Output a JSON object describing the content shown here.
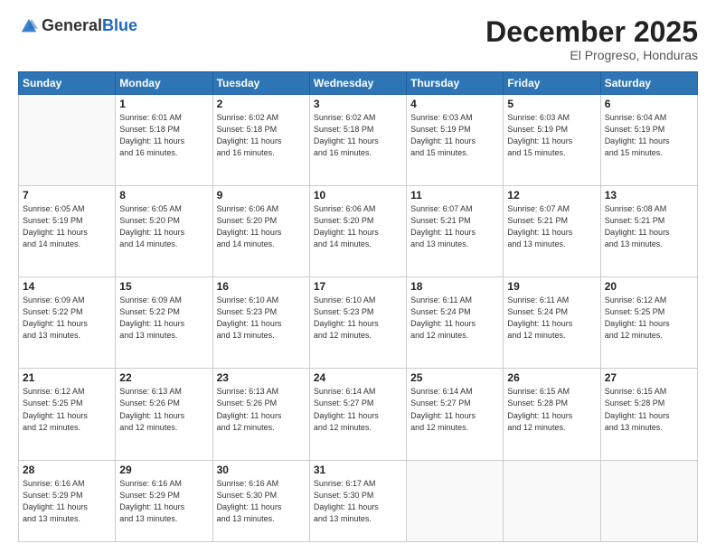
{
  "logo": {
    "general": "General",
    "blue": "Blue"
  },
  "title": {
    "month": "December 2025",
    "location": "El Progreso, Honduras"
  },
  "weekdays": [
    "Sunday",
    "Monday",
    "Tuesday",
    "Wednesday",
    "Thursday",
    "Friday",
    "Saturday"
  ],
  "weeks": [
    [
      {
        "day": "",
        "sunrise": "",
        "sunset": "",
        "daylight": ""
      },
      {
        "day": "1",
        "sunrise": "6:01 AM",
        "sunset": "5:18 PM",
        "daylight": "11 hours and 16 minutes."
      },
      {
        "day": "2",
        "sunrise": "6:02 AM",
        "sunset": "5:18 PM",
        "daylight": "11 hours and 16 minutes."
      },
      {
        "day": "3",
        "sunrise": "6:02 AM",
        "sunset": "5:18 PM",
        "daylight": "11 hours and 16 minutes."
      },
      {
        "day": "4",
        "sunrise": "6:03 AM",
        "sunset": "5:19 PM",
        "daylight": "11 hours and 15 minutes."
      },
      {
        "day": "5",
        "sunrise": "6:03 AM",
        "sunset": "5:19 PM",
        "daylight": "11 hours and 15 minutes."
      },
      {
        "day": "6",
        "sunrise": "6:04 AM",
        "sunset": "5:19 PM",
        "daylight": "11 hours and 15 minutes."
      }
    ],
    [
      {
        "day": "7",
        "sunrise": "6:05 AM",
        "sunset": "5:19 PM",
        "daylight": "11 hours and 14 minutes."
      },
      {
        "day": "8",
        "sunrise": "6:05 AM",
        "sunset": "5:20 PM",
        "daylight": "11 hours and 14 minutes."
      },
      {
        "day": "9",
        "sunrise": "6:06 AM",
        "sunset": "5:20 PM",
        "daylight": "11 hours and 14 minutes."
      },
      {
        "day": "10",
        "sunrise": "6:06 AM",
        "sunset": "5:20 PM",
        "daylight": "11 hours and 14 minutes."
      },
      {
        "day": "11",
        "sunrise": "6:07 AM",
        "sunset": "5:21 PM",
        "daylight": "11 hours and 13 minutes."
      },
      {
        "day": "12",
        "sunrise": "6:07 AM",
        "sunset": "5:21 PM",
        "daylight": "11 hours and 13 minutes."
      },
      {
        "day": "13",
        "sunrise": "6:08 AM",
        "sunset": "5:21 PM",
        "daylight": "11 hours and 13 minutes."
      }
    ],
    [
      {
        "day": "14",
        "sunrise": "6:09 AM",
        "sunset": "5:22 PM",
        "daylight": "11 hours and 13 minutes."
      },
      {
        "day": "15",
        "sunrise": "6:09 AM",
        "sunset": "5:22 PM",
        "daylight": "11 hours and 13 minutes."
      },
      {
        "day": "16",
        "sunrise": "6:10 AM",
        "sunset": "5:23 PM",
        "daylight": "11 hours and 13 minutes."
      },
      {
        "day": "17",
        "sunrise": "6:10 AM",
        "sunset": "5:23 PM",
        "daylight": "11 hours and 12 minutes."
      },
      {
        "day": "18",
        "sunrise": "6:11 AM",
        "sunset": "5:24 PM",
        "daylight": "11 hours and 12 minutes."
      },
      {
        "day": "19",
        "sunrise": "6:11 AM",
        "sunset": "5:24 PM",
        "daylight": "11 hours and 12 minutes."
      },
      {
        "day": "20",
        "sunrise": "6:12 AM",
        "sunset": "5:25 PM",
        "daylight": "11 hours and 12 minutes."
      }
    ],
    [
      {
        "day": "21",
        "sunrise": "6:12 AM",
        "sunset": "5:25 PM",
        "daylight": "11 hours and 12 minutes."
      },
      {
        "day": "22",
        "sunrise": "6:13 AM",
        "sunset": "5:26 PM",
        "daylight": "11 hours and 12 minutes."
      },
      {
        "day": "23",
        "sunrise": "6:13 AM",
        "sunset": "5:26 PM",
        "daylight": "11 hours and 12 minutes."
      },
      {
        "day": "24",
        "sunrise": "6:14 AM",
        "sunset": "5:27 PM",
        "daylight": "11 hours and 12 minutes."
      },
      {
        "day": "25",
        "sunrise": "6:14 AM",
        "sunset": "5:27 PM",
        "daylight": "11 hours and 12 minutes."
      },
      {
        "day": "26",
        "sunrise": "6:15 AM",
        "sunset": "5:28 PM",
        "daylight": "11 hours and 12 minutes."
      },
      {
        "day": "27",
        "sunrise": "6:15 AM",
        "sunset": "5:28 PM",
        "daylight": "11 hours and 13 minutes."
      }
    ],
    [
      {
        "day": "28",
        "sunrise": "6:16 AM",
        "sunset": "5:29 PM",
        "daylight": "11 hours and 13 minutes."
      },
      {
        "day": "29",
        "sunrise": "6:16 AM",
        "sunset": "5:29 PM",
        "daylight": "11 hours and 13 minutes."
      },
      {
        "day": "30",
        "sunrise": "6:16 AM",
        "sunset": "5:30 PM",
        "daylight": "11 hours and 13 minutes."
      },
      {
        "day": "31",
        "sunrise": "6:17 AM",
        "sunset": "5:30 PM",
        "daylight": "11 hours and 13 minutes."
      },
      {
        "day": "",
        "sunrise": "",
        "sunset": "",
        "daylight": ""
      },
      {
        "day": "",
        "sunrise": "",
        "sunset": "",
        "daylight": ""
      },
      {
        "day": "",
        "sunrise": "",
        "sunset": "",
        "daylight": ""
      }
    ]
  ],
  "labels": {
    "sunrise": "Sunrise:",
    "sunset": "Sunset:",
    "daylight": "Daylight:"
  }
}
